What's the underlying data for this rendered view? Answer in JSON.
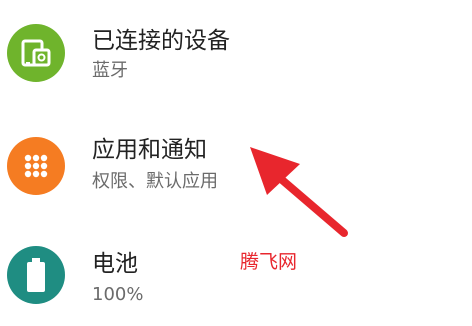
{
  "settings": {
    "items": [
      {
        "title": "已连接的设备",
        "subtitle": "蓝牙",
        "icon": "devices-icon",
        "color": "#6fb42c"
      },
      {
        "title": "应用和通知",
        "subtitle": "权限、默认应用",
        "icon": "apps-grid-icon",
        "color": "#f57c22"
      },
      {
        "title": "电池",
        "subtitle": "100%",
        "icon": "battery-icon",
        "color": "#1f8d82"
      }
    ]
  },
  "watermark": {
    "text": "腾飞网",
    "color": "#e8262d"
  },
  "annotation": {
    "arrow_color": "#e8262d"
  }
}
